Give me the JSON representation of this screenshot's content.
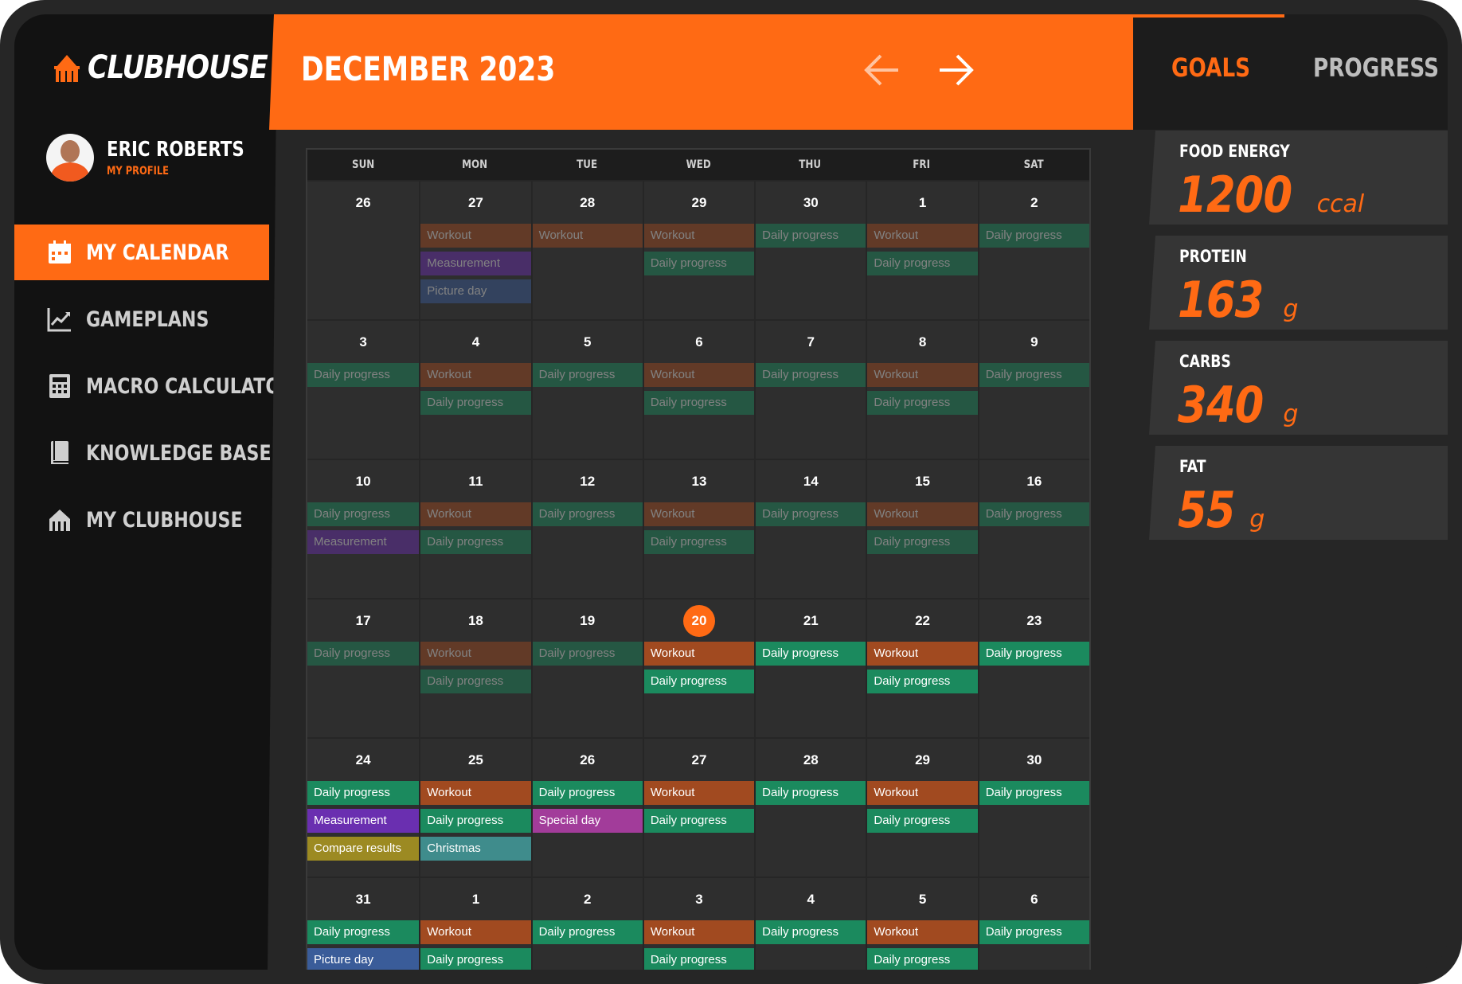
{
  "app": {
    "name": "CLUBHOUSE"
  },
  "colors": {
    "accent": "#ff6a14",
    "workout": "#a14a20",
    "daily_progress": "#1b8a5e",
    "measurement": "#6a2fb0",
    "picture_day": "#3a5c99",
    "special_day": "#a23c9a",
    "christmas": "#3f8c8c",
    "compare_results": "#9c8a22"
  },
  "profile": {
    "name": "ERIC ROBERTS",
    "link": "MY PROFILE"
  },
  "nav": [
    {
      "label": "MY CALENDAR",
      "icon": "calendar-icon",
      "active": true
    },
    {
      "label": "GAMEPLANS",
      "icon": "chart-icon",
      "active": false
    },
    {
      "label": "MACRO CALCULATOR",
      "icon": "calculator-icon",
      "active": false
    },
    {
      "label": "KNOWLEDGE BASE",
      "icon": "book-icon",
      "active": false
    },
    {
      "label": "MY CLUBHOUSE",
      "icon": "clubhouse-icon",
      "active": false
    }
  ],
  "header": {
    "title": "DECEMBER 2023"
  },
  "right_tabs": {
    "goals": "GOALS",
    "progress": "PROGRESS"
  },
  "macros": [
    {
      "label": "FOOD ENERGY",
      "value": "1200",
      "unit": "ccal"
    },
    {
      "label": "PROTEIN",
      "value": "163",
      "unit": "g"
    },
    {
      "label": "CARBS",
      "value": "340",
      "unit": "g"
    },
    {
      "label": "FAT",
      "value": "55",
      "unit": "g"
    }
  ],
  "calendar": {
    "days_of_week": [
      "SUN",
      "MON",
      "TUE",
      "WED",
      "THU",
      "FRI",
      "SAT"
    ],
    "weeks": [
      [
        {
          "day": "26",
          "events": []
        },
        {
          "day": "27",
          "events": [
            {
              "label": "Workout",
              "type": "workout"
            },
            {
              "label": "Measurement",
              "type": "measurement"
            },
            {
              "label": "Picture day",
              "type": "picture_day"
            }
          ]
        },
        {
          "day": "28",
          "events": [
            {
              "label": "Workout",
              "type": "workout"
            }
          ]
        },
        {
          "day": "29",
          "events": [
            {
              "label": "Workout",
              "type": "workout"
            },
            {
              "label": "Daily progress",
              "type": "daily_progress"
            }
          ]
        },
        {
          "day": "30",
          "events": [
            {
              "label": "Daily progress",
              "type": "daily_progress"
            }
          ]
        },
        {
          "day": "1",
          "events": [
            {
              "label": "Workout",
              "type": "workout"
            },
            {
              "label": "Daily progress",
              "type": "daily_progress"
            }
          ]
        },
        {
          "day": "2",
          "events": [
            {
              "label": "Daily progress",
              "type": "daily_progress"
            }
          ]
        }
      ],
      [
        {
          "day": "3",
          "events": [
            {
              "label": "Daily progress",
              "type": "daily_progress"
            }
          ]
        },
        {
          "day": "4",
          "events": [
            {
              "label": "Workout",
              "type": "workout"
            },
            {
              "label": "Daily progress",
              "type": "daily_progress"
            }
          ]
        },
        {
          "day": "5",
          "events": [
            {
              "label": "Daily progress",
              "type": "daily_progress"
            }
          ]
        },
        {
          "day": "6",
          "events": [
            {
              "label": "Workout",
              "type": "workout"
            },
            {
              "label": "Daily progress",
              "type": "daily_progress"
            }
          ]
        },
        {
          "day": "7",
          "events": [
            {
              "label": "Daily progress",
              "type": "daily_progress"
            }
          ]
        },
        {
          "day": "8",
          "events": [
            {
              "label": "Workout",
              "type": "workout"
            },
            {
              "label": "Daily progress",
              "type": "daily_progress"
            }
          ]
        },
        {
          "day": "9",
          "events": [
            {
              "label": "Daily progress",
              "type": "daily_progress"
            }
          ]
        }
      ],
      [
        {
          "day": "10",
          "events": [
            {
              "label": "Daily progress",
              "type": "daily_progress"
            },
            {
              "label": "Measurement",
              "type": "measurement"
            }
          ]
        },
        {
          "day": "11",
          "events": [
            {
              "label": "Workout",
              "type": "workout"
            },
            {
              "label": "Daily progress",
              "type": "daily_progress"
            }
          ]
        },
        {
          "day": "12",
          "events": [
            {
              "label": "Daily progress",
              "type": "daily_progress"
            }
          ]
        },
        {
          "day": "13",
          "events": [
            {
              "label": "Workout",
              "type": "workout"
            },
            {
              "label": "Daily progress",
              "type": "daily_progress"
            }
          ]
        },
        {
          "day": "14",
          "events": [
            {
              "label": "Daily progress",
              "type": "daily_progress"
            }
          ]
        },
        {
          "day": "15",
          "events": [
            {
              "label": "Workout",
              "type": "workout"
            },
            {
              "label": "Daily progress",
              "type": "daily_progress"
            }
          ]
        },
        {
          "day": "16",
          "events": [
            {
              "label": "Daily progress",
              "type": "daily_progress"
            }
          ]
        }
      ],
      [
        {
          "day": "17",
          "events": [
            {
              "label": "Daily progress",
              "type": "daily_progress"
            }
          ]
        },
        {
          "day": "18",
          "events": [
            {
              "label": "Workout",
              "type": "workout"
            },
            {
              "label": "Daily progress",
              "type": "daily_progress"
            }
          ]
        },
        {
          "day": "19",
          "events": [
            {
              "label": "Daily progress",
              "type": "daily_progress"
            }
          ]
        },
        {
          "day": "20",
          "today": true,
          "events": [
            {
              "label": "Workout",
              "type": "workout"
            },
            {
              "label": "Daily progress",
              "type": "daily_progress"
            }
          ]
        },
        {
          "day": "21",
          "events": [
            {
              "label": "Daily progress",
              "type": "daily_progress"
            }
          ]
        },
        {
          "day": "22",
          "events": [
            {
              "label": "Workout",
              "type": "workout"
            },
            {
              "label": "Daily progress",
              "type": "daily_progress"
            }
          ]
        },
        {
          "day": "23",
          "events": [
            {
              "label": "Daily progress",
              "type": "daily_progress"
            }
          ]
        }
      ],
      [
        {
          "day": "24",
          "events": [
            {
              "label": "Daily progress",
              "type": "daily_progress"
            },
            {
              "label": "Measurement",
              "type": "measurement"
            },
            {
              "label": "Compare results",
              "type": "compare_results"
            }
          ]
        },
        {
          "day": "25",
          "events": [
            {
              "label": "Workout",
              "type": "workout"
            },
            {
              "label": "Daily progress",
              "type": "daily_progress"
            },
            {
              "label": "Christmas",
              "type": "christmas"
            }
          ]
        },
        {
          "day": "26",
          "events": [
            {
              "label": "Daily progress",
              "type": "daily_progress"
            },
            {
              "label": "Special day",
              "type": "special_day"
            }
          ]
        },
        {
          "day": "27",
          "events": [
            {
              "label": "Workout",
              "type": "workout"
            },
            {
              "label": "Daily progress",
              "type": "daily_progress"
            }
          ]
        },
        {
          "day": "28",
          "events": [
            {
              "label": "Daily progress",
              "type": "daily_progress"
            }
          ]
        },
        {
          "day": "29",
          "events": [
            {
              "label": "Workout",
              "type": "workout"
            },
            {
              "label": "Daily progress",
              "type": "daily_progress"
            }
          ]
        },
        {
          "day": "30",
          "events": [
            {
              "label": "Daily progress",
              "type": "daily_progress"
            }
          ]
        }
      ],
      [
        {
          "day": "31",
          "events": [
            {
              "label": "Daily progress",
              "type": "daily_progress"
            },
            {
              "label": "Picture day",
              "type": "picture_day"
            }
          ]
        },
        {
          "day": "1",
          "events": [
            {
              "label": "Workout",
              "type": "workout"
            },
            {
              "label": "Daily progress",
              "type": "daily_progress"
            }
          ]
        },
        {
          "day": "2",
          "events": [
            {
              "label": "Daily progress",
              "type": "daily_progress"
            }
          ]
        },
        {
          "day": "3",
          "events": [
            {
              "label": "Workout",
              "type": "workout"
            },
            {
              "label": "Daily progress",
              "type": "daily_progress"
            }
          ]
        },
        {
          "day": "4",
          "events": [
            {
              "label": "Daily progress",
              "type": "daily_progress"
            }
          ]
        },
        {
          "day": "5",
          "events": [
            {
              "label": "Workout",
              "type": "workout"
            },
            {
              "label": "Daily progress",
              "type": "daily_progress"
            }
          ]
        },
        {
          "day": "6",
          "events": [
            {
              "label": "Daily progress",
              "type": "daily_progress"
            }
          ]
        }
      ]
    ]
  }
}
